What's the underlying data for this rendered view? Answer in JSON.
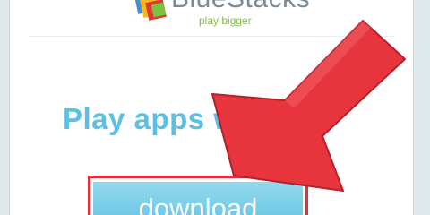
{
  "brand": {
    "name": "BlueStacks",
    "tagline": "play bigger"
  },
  "hero": {
    "headline": "Play apps whe"
  },
  "download": {
    "label": "download"
  },
  "colors": {
    "headline": "#5bc0e6",
    "button": "#7ccfea",
    "highlight": "#e0323c",
    "arrow": "#e8343d",
    "tagline": "#7cc242"
  },
  "annotation": {
    "type": "arrow",
    "icon": "red-arrow-icon"
  }
}
